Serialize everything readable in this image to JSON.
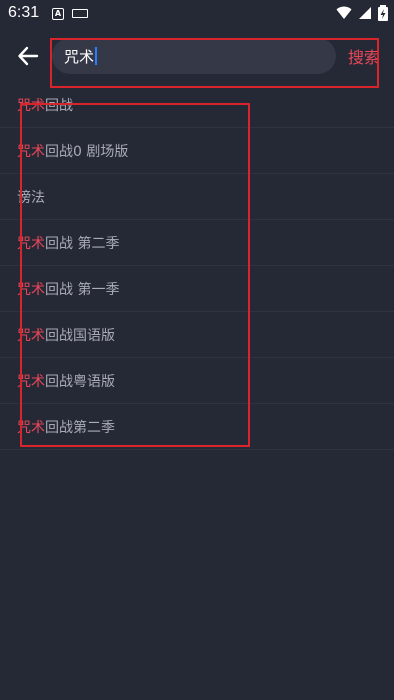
{
  "status_bar": {
    "time": "6:31",
    "notification_letter": "A",
    "icons": [
      "notification-a-icon",
      "keyboard-icon",
      "wifi-icon",
      "signal-icon",
      "battery-charging-icon"
    ]
  },
  "search": {
    "back_icon": "arrow-left-icon",
    "query": "咒术",
    "submit_label": "搜索"
  },
  "suggestions": [
    {
      "highlight": "咒术",
      "rest": "回战"
    },
    {
      "highlight": "咒术",
      "rest": "回战0 剧场版"
    },
    {
      "highlight": "",
      "rest": "谤法"
    },
    {
      "highlight": "咒术",
      "rest": "回战 第二季"
    },
    {
      "highlight": "咒术",
      "rest": "回战 第一季"
    },
    {
      "highlight": "咒术",
      "rest": "回战国语版"
    },
    {
      "highlight": "咒术",
      "rest": "回战粤语版"
    },
    {
      "highlight": "咒术",
      "rest": "回战第二季"
    }
  ],
  "colors": {
    "background": "#252835",
    "accent": "#e8485a",
    "search_box": "#343847",
    "annotation": "#d9242c"
  }
}
